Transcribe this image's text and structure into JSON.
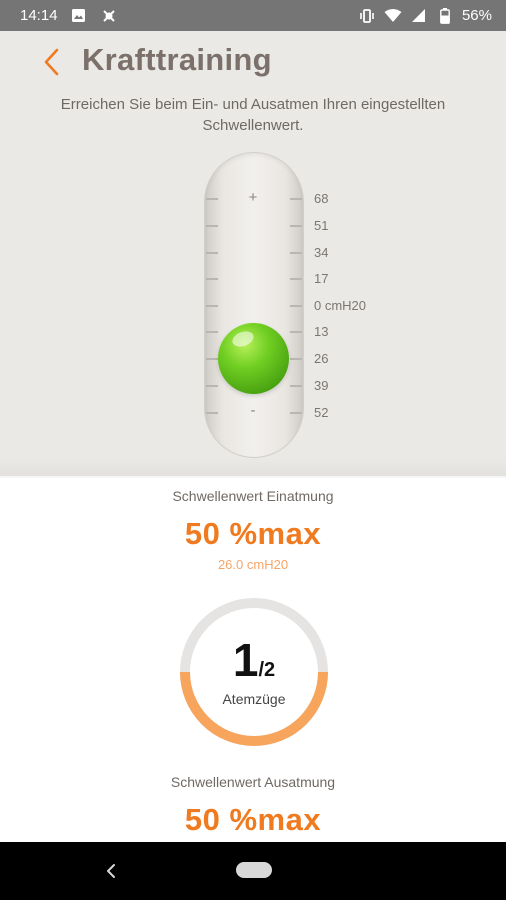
{
  "status_bar": {
    "time": "14:14",
    "battery": "56%",
    "icons": [
      "image-icon",
      "bug-icon",
      "vibrate-icon",
      "wifi-icon",
      "signal-icon",
      "battery-icon"
    ]
  },
  "header": {
    "title": "Krafttraining",
    "subtitle": "Erreichen Sie beim Ein- und Ausatmen Ihren eingestellten Schwellenwert."
  },
  "gauge": {
    "plus_label": "+",
    "minus_label": "-",
    "scale": [
      "68",
      "51",
      "34",
      "17",
      "0 cmH20",
      "13",
      "26",
      "39",
      "52"
    ]
  },
  "inhale": {
    "label": "Schwellenwert Einatmung",
    "value": "50 %max",
    "sub_value": "26.0 cmH20"
  },
  "counter": {
    "current": "1",
    "total": "/2",
    "label": "Atemzüge",
    "progress": 0.5
  },
  "exhale": {
    "label": "Schwellenwert Ausatmung",
    "value": "50 %max"
  },
  "colors": {
    "accent": "#f07a1f",
    "accent_light": "#f7a45c",
    "ball_green": "#5cb81a",
    "background_top": "#ebe9e6",
    "text_muted": "#6f6964"
  }
}
